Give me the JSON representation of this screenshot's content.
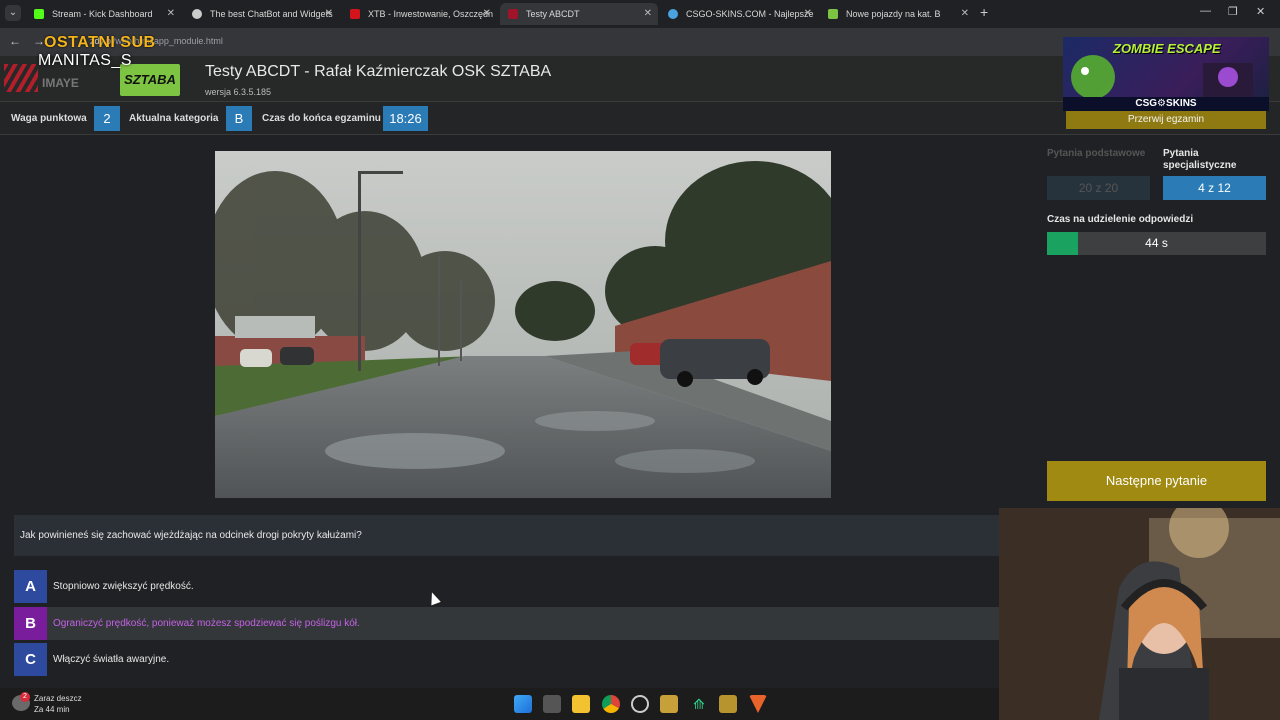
{
  "browser": {
    "tabs": [
      {
        "label": "Stream - Kick Dashboard",
        "favicon_color": "#53fc18"
      },
      {
        "label": "The best ChatBot and Widgets",
        "favicon_color": "#cccccc"
      },
      {
        "label": "XTB - Inwestowanie, Oszczędn",
        "favicon_color": "#d3141d"
      },
      {
        "label": "Testy ABCDT",
        "favicon_color": "#a0142a"
      },
      {
        "label": "CSGO-SKINS.COM - Najlepsze",
        "favicon_color": "#4aa3df"
      },
      {
        "label": "Nowe pojazdy na kat. B",
        "favicon_color": "#7ec443"
      }
    ],
    "active_tab_index": 3,
    "new_tab_label": "+",
    "url_domain": "zdy.pl",
    "url_path": "/web/html/app_module.html"
  },
  "overlay": {
    "title": "OSTATNI SUB",
    "name": "MANITAS_S",
    "subtitle": "IMAYE"
  },
  "app": {
    "logo_label": "SZTABA",
    "title": "Testy ABCDT - Rafał Kaźmierczak OSK SZTABA",
    "version": "wersja 6.3.5.185"
  },
  "info": {
    "weight_label": "Waga punktowa",
    "weight_value": "2",
    "category_label": "Aktualna kategoria",
    "category_value": "B",
    "time_label": "Czas do końca egzaminu",
    "time_value": "18:26"
  },
  "right_panel": {
    "stop_exam": "Przerwij egzamin",
    "basic_label": "Pytania podstawowe",
    "basic_value": "20 z 20",
    "special_label": "Pytania specjalistyczne",
    "special_value": "4 z 12",
    "answer_time_label": "Czas na udzielenie odpowiedzi",
    "answer_time_value": "44 s",
    "answer_time_fraction": 0.14,
    "next_button": "Następne pytanie"
  },
  "promo": {
    "title": "ZOMBIE ESCAPE",
    "brand": "CSG⚙SKINS"
  },
  "question": {
    "text": "Jak powinieneś się zachować wjeżdżając na odcinek drogi pokryty kałużami?",
    "answers": [
      {
        "letter": "A",
        "text": "Stopniowo zwiększyć prędkość.",
        "color": "#2e4a9e",
        "selected": false
      },
      {
        "letter": "B",
        "text": "Ograniczyć prędkość, ponieważ możesz spodziewać się poślizgu kół.",
        "color": "#7a1d9c",
        "selected": true
      },
      {
        "letter": "C",
        "text": "Włączyć światła awaryjne.",
        "color": "#2e4a9e",
        "selected": false
      }
    ]
  },
  "taskbar": {
    "weather_title": "Zaraz deszcz",
    "weather_sub": "Za 44 min",
    "weather_badge": "2"
  },
  "colors": {
    "accent_blue": "#2a7bb6",
    "accent_gold": "#a08a12",
    "timer_green": "#1aa260",
    "selected_answer_text": "#c561e6"
  }
}
